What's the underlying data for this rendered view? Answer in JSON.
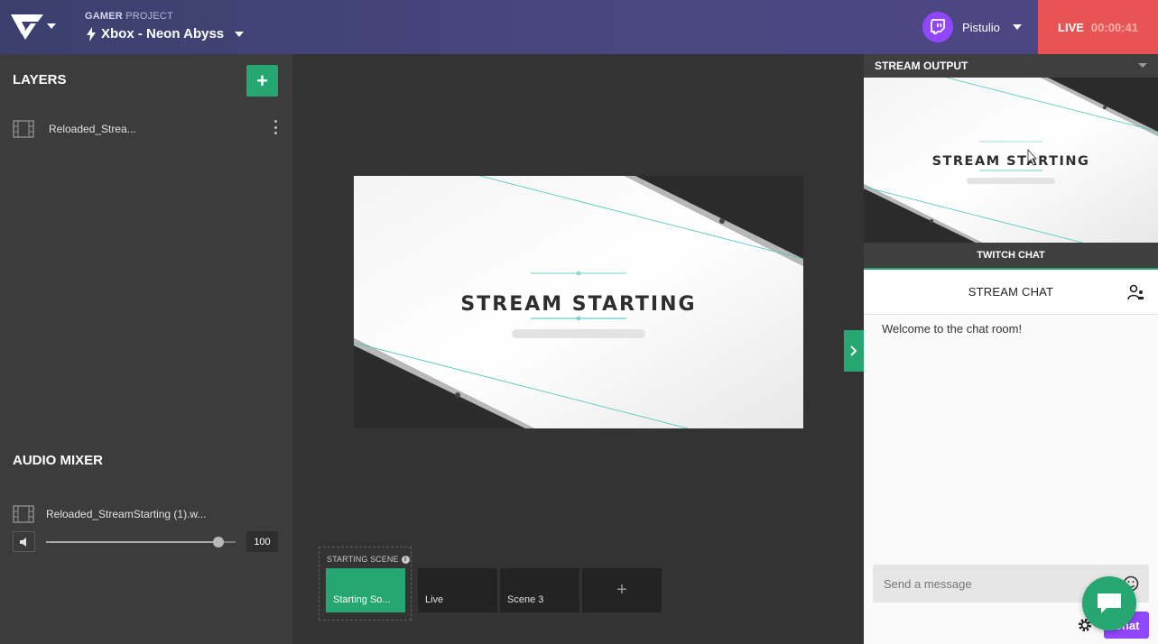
{
  "header": {
    "project_label_bold": "GAMER",
    "project_label_rest": " PROJECT",
    "project_name": "Xbox - Neon Abyss",
    "username": "Pistulio",
    "live_label": "LIVE",
    "live_timer": "00:00:41"
  },
  "layers": {
    "title": "LAYERS",
    "add_label": "+",
    "items": [
      {
        "name": "Reloaded_Strea..."
      }
    ]
  },
  "audio_mixer": {
    "title": "AUDIO MIXER",
    "items": [
      {
        "name": "Reloaded_StreamStarting (1).w...",
        "volume": 100,
        "volume_label": "100"
      }
    ]
  },
  "preview": {
    "overlay_text": "STREAM STARTING"
  },
  "scenes": {
    "group_label": "STARTING SCENE",
    "info_label": "i",
    "add_label": "+",
    "items": [
      {
        "name": "Starting So...",
        "active": true
      },
      {
        "name": "Live",
        "active": false
      },
      {
        "name": "Scene 3",
        "active": false
      }
    ]
  },
  "stream_output": {
    "title": "STREAM OUTPUT",
    "overlay_text": "STREAM STARTING"
  },
  "chat": {
    "tab_label": "TWITCH CHAT",
    "header": "STREAM CHAT",
    "welcome": "Welcome to the chat room!",
    "input_placeholder": "Send a message",
    "send_label": "Chat"
  },
  "colors": {
    "accent_green": "#26a671",
    "live_red": "#e85454",
    "twitch_purple": "#9146ff",
    "header_bg": "#4a4780"
  },
  "icons": [
    "logo-icon",
    "bolt-icon",
    "twitch-icon",
    "film-icon",
    "kebab-icon",
    "speaker-icon",
    "info-icon",
    "chevron-right-icon",
    "users-icon",
    "emoji-icon",
    "gear-icon",
    "chat-bubble-icon"
  ]
}
